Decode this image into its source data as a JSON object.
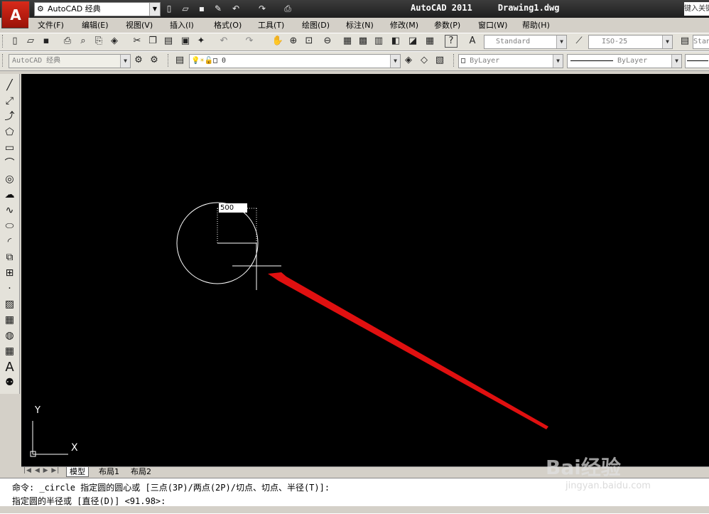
{
  "title_bar": {
    "app_logo": "A",
    "workspace": "AutoCAD 经典",
    "title": "AutoCAD 2011     Drawing1.dwg",
    "search_placeholder": "键入关键字或短语"
  },
  "quick_access": [
    "new-icon",
    "open-icon",
    "save-icon",
    "saveas-icon",
    "undo-icon",
    "redo-icon",
    "plot-icon"
  ],
  "menu": [
    "文件(F)",
    "编辑(E)",
    "视图(V)",
    "插入(I)",
    "格式(O)",
    "工具(T)",
    "绘图(D)",
    "标注(N)",
    "修改(M)",
    "参数(P)",
    "窗口(W)",
    "帮助(H)"
  ],
  "standard_toolbar": {
    "text_style": "Standard",
    "dim_style": "ISO-25",
    "table_style": "Standard"
  },
  "workspace_toolbar": {
    "workspace": "AutoCAD 经典"
  },
  "layers_toolbar": {
    "current_layer": "0"
  },
  "properties_toolbar": {
    "color": "ByLayer",
    "linetype": "ByLayer"
  },
  "canvas": {
    "dimension_input": "500",
    "ucs_x": "X",
    "ucs_y": "Y"
  },
  "layout_tabs": [
    "模型",
    "布局1",
    "布局2"
  ],
  "command": {
    "line1": "命令: _circle 指定圆的圆心或 [三点(3P)/两点(2P)/切点、切点、半径(T)]:",
    "line2": "指定圆的半径或 [直径(D)] <91.98>:"
  },
  "watermark": {
    "brand": "Bai经验",
    "url": "jingyan.baidu.com"
  },
  "colors": {
    "canvas_bg": "#000000",
    "arrow": "#e01010",
    "title_bg": "#2a2a2a"
  }
}
